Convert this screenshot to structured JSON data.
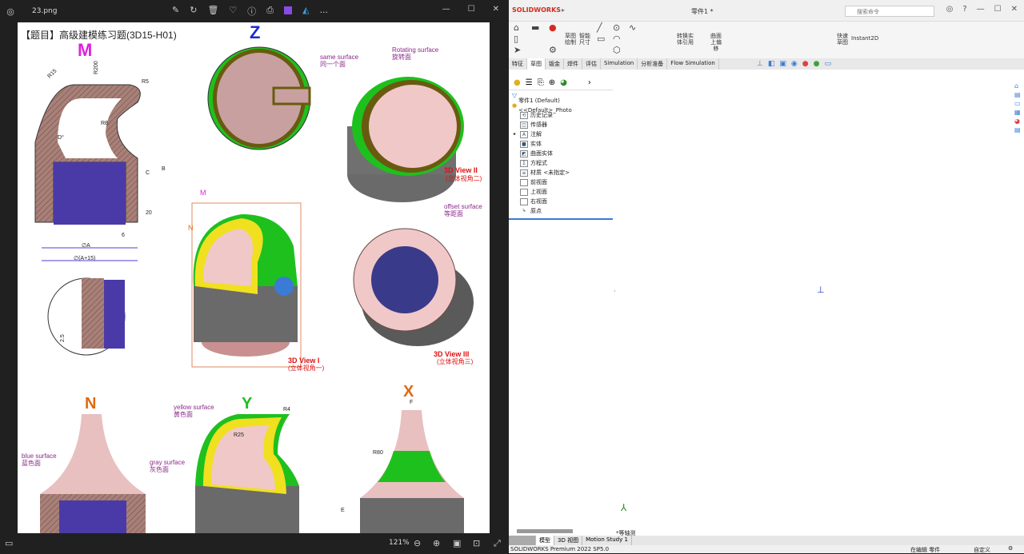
{
  "viewer": {
    "file_name": "23.png",
    "toolbar_icons": [
      "edit-icon",
      "rotate-icon",
      "delete-icon",
      "favorite-icon",
      "info-icon",
      "print-icon",
      "clipchamp-icon",
      "photos-icon",
      "more-icon"
    ],
    "more_label": "...",
    "zoom_level": "121%",
    "drawing": {
      "title": "【题目】高级建模练习题(3D15-H01)",
      "views": {
        "M": "M",
        "Z": "Z",
        "N": "N",
        "Y": "Y",
        "X": "X"
      },
      "dims": [
        "R15",
        "R200",
        "R5",
        "R8",
        "D°",
        "C",
        "B",
        "20",
        "6",
        "∅A",
        "∅(A+15)",
        "2.5",
        "R4",
        "R25",
        "F",
        "R80",
        "E",
        "A"
      ],
      "labels": {
        "same_surface": "same surface",
        "same_surface_cn": "同一个面",
        "rotating_surface": "Rotating surface",
        "rotating_surface_cn": "旋转面",
        "view2": "3D View II",
        "view2_cn": "(立体视角二)",
        "offset_surface": "offset surface",
        "offset_surface_cn": "等距面",
        "view1": "3D View I",
        "view1_cn": "(立体视角一)",
        "view3": "3D View III",
        "view3_cn": "(立体视角三)",
        "blue_surface": "blue surface",
        "blue_surface_cn": "蓝色面",
        "yellow_surface": "yellow surface",
        "yellow_surface_cn": "黄色面",
        "gray_surface": "gray surface",
        "gray_surface_cn": "灰色面"
      }
    }
  },
  "solidworks": {
    "brand": "SOLIDWORKS",
    "doc_title": "零件1 *",
    "search_placeholder": "搜索命令",
    "ribbon": {
      "sketch": "草图\n绘制",
      "smart_dim": "智能\n尺寸",
      "convert": "转换实\n体引用",
      "offset_surface": "曲面\n上偏\n移",
      "quick_snap": "快速\n草图",
      "instant2d": "Instant2D"
    },
    "tabs": [
      "特征",
      "草图",
      "钣金",
      "焊件",
      "评估",
      "Simulation",
      "分析准备",
      "Flow Simulation"
    ],
    "active_tab": "草图",
    "tree": {
      "root": "零件1 (Default) <<Default>_Photo",
      "items": [
        "历史记录",
        "传感器",
        "注解",
        "实体",
        "曲面实体",
        "方程式",
        "材质 <未指定>",
        "前视面",
        "上视面",
        "右视面",
        "原点"
      ]
    },
    "view_label": "*等轴测",
    "bottom_tabs": [
      "模型",
      "3D 视图",
      "Motion Study 1"
    ],
    "status": {
      "product": "SOLIDWORKS Premium 2022 SP5.0",
      "editing": "在编辑 零件",
      "units": "自定义"
    }
  },
  "colors": {
    "accent": "#3a7bd5",
    "sw_red": "#d52b1e",
    "magenta": "#e020e0",
    "blue_view": "#1a2ad8",
    "green": "#1ec01e",
    "orange": "#e06a10",
    "label_purple": "#8a2a8a",
    "view_red": "#e01010"
  }
}
